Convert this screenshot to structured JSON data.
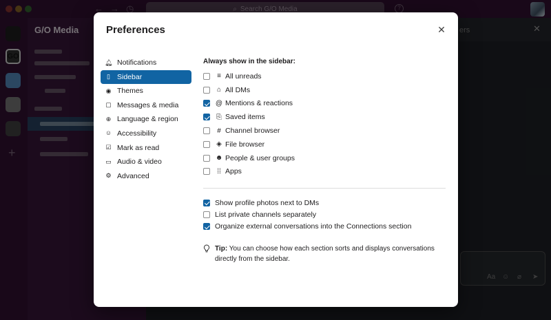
{
  "window": {
    "search_placeholder": "Search G/O Media",
    "help_glyph": "?"
  },
  "workspace": {
    "name": "G/O Media",
    "go_label": "GO"
  },
  "thread_panel": {
    "header_fragment": "ers"
  },
  "modal": {
    "title": "Preferences",
    "close_glyph": "✕",
    "nav": [
      {
        "label": "Notifications",
        "icon": "bell-icon",
        "glyph": "🔔︎",
        "active": false
      },
      {
        "label": "Sidebar",
        "icon": "sidebar-icon",
        "glyph": "▯",
        "active": true
      },
      {
        "label": "Themes",
        "icon": "eye-icon",
        "glyph": "◉",
        "active": false
      },
      {
        "label": "Messages & media",
        "icon": "message-icon",
        "glyph": "▢",
        "active": false
      },
      {
        "label": "Language & region",
        "icon": "globe-icon",
        "glyph": "⊕",
        "active": false
      },
      {
        "label": "Accessibility",
        "icon": "accessibility-icon",
        "glyph": "☺",
        "active": false
      },
      {
        "label": "Mark as read",
        "icon": "check-square-icon",
        "glyph": "☑",
        "active": false
      },
      {
        "label": "Audio & video",
        "icon": "video-icon",
        "glyph": "▭",
        "active": false
      },
      {
        "label": "Advanced",
        "icon": "gear-icon",
        "glyph": "⚙",
        "active": false
      }
    ],
    "sidebar_section": {
      "heading": "Always show in the sidebar:",
      "options": [
        {
          "label": "All unreads",
          "icon": "list-icon",
          "glyph": "≡",
          "checked": false
        },
        {
          "label": "All DMs",
          "icon": "dm-icon",
          "glyph": "⌂",
          "checked": false
        },
        {
          "label": "Mentions & reactions",
          "icon": "at-icon",
          "glyph": "@",
          "checked": true
        },
        {
          "label": "Saved items",
          "icon": "bookmark-icon",
          "glyph": "⎘",
          "checked": true
        },
        {
          "label": "Channel browser",
          "icon": "channel-icon",
          "glyph": "#",
          "checked": false
        },
        {
          "label": "File browser",
          "icon": "layers-icon",
          "glyph": "◈",
          "checked": false
        },
        {
          "label": "People & user groups",
          "icon": "people-icon",
          "glyph": "☻",
          "checked": false
        },
        {
          "label": "Apps",
          "icon": "apps-icon",
          "glyph": "⁞⁞",
          "checked": false
        }
      ]
    },
    "extra_options": [
      {
        "label": "Show profile photos next to DMs",
        "checked": true
      },
      {
        "label": "List private channels separately",
        "checked": false
      },
      {
        "label": "Organize external conversations into the Connections section",
        "checked": true
      }
    ],
    "tip": {
      "bold": "Tip:",
      "text": " You can choose how each section sorts and displays conversations directly from the sidebar.",
      "icon": "lightbulb-icon"
    }
  }
}
